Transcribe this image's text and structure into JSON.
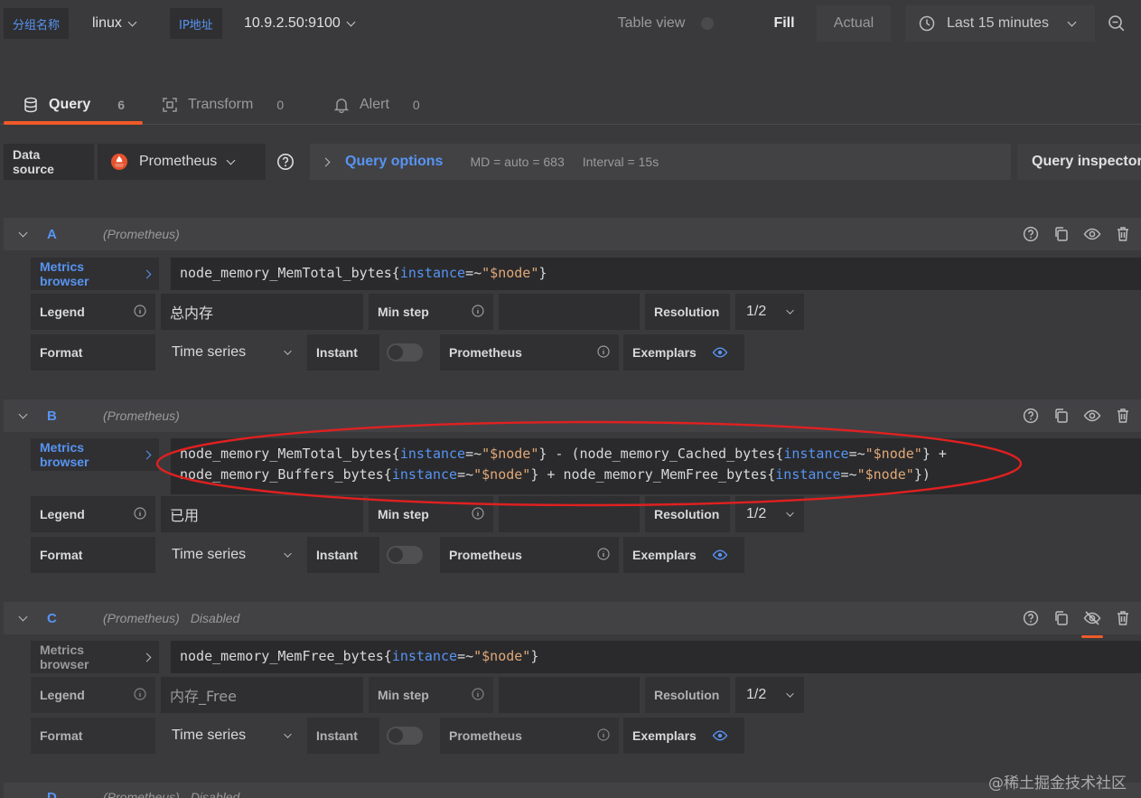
{
  "topbar": {
    "var1_label": "分组名称",
    "var1_value": "linux",
    "var2_label": "IP地址",
    "var2_value": "10.9.2.50:9100",
    "table_view_label": "Table view",
    "fill_label": "Fill",
    "actual_label": "Actual",
    "time_range": "Last 15 minutes"
  },
  "tabs": [
    {
      "label": "Query",
      "count": "6"
    },
    {
      "label": "Transform",
      "count": "0"
    },
    {
      "label": "Alert",
      "count": "0"
    }
  ],
  "datasource": {
    "label": "Data source",
    "value": "Prometheus",
    "query_options_label": "Query options",
    "md": "MD = auto = 683",
    "interval": "Interval = 15s",
    "inspector_label": "Query inspector"
  },
  "common": {
    "metrics_browser": "Metrics browser",
    "legend": "Legend",
    "min_step": "Min step",
    "resolution": "Resolution",
    "format": "Format",
    "format_value": "Time series",
    "instant": "Instant",
    "prometheus": "Prometheus",
    "exemplars": "Exemplars",
    "resolution_value": "1/2"
  },
  "queries": [
    {
      "letter": "A",
      "datasource": "(Prometheus)",
      "disabled": "",
      "expr_lines": [
        [
          [
            "node_memory_MemTotal_bytes{",
            "t"
          ],
          [
            "instance",
            "k"
          ],
          [
            "=~",
            "t"
          ],
          [
            "\"$node\"",
            "s"
          ],
          [
            "}",
            "t"
          ]
        ]
      ],
      "legend": "总内存"
    },
    {
      "letter": "B",
      "datasource": "(Prometheus)",
      "disabled": "",
      "expr_lines": [
        [
          [
            "node_memory_MemTotal_bytes{",
            "t"
          ],
          [
            "instance",
            "k"
          ],
          [
            "=~",
            "t"
          ],
          [
            "\"$node\"",
            "s"
          ],
          [
            "} - (node_memory_Cached_bytes{",
            "t"
          ],
          [
            "instance",
            "k"
          ],
          [
            "=~",
            "t"
          ],
          [
            "\"$node\"",
            "s"
          ],
          [
            "} +",
            "t"
          ]
        ],
        [
          [
            "node_memory_Buffers_bytes{",
            "t"
          ],
          [
            "instance",
            "k"
          ],
          [
            "=~",
            "t"
          ],
          [
            "\"$node\"",
            "s"
          ],
          [
            "} + node_memory_MemFree_bytes{",
            "t"
          ],
          [
            "instance",
            "k"
          ],
          [
            "=~",
            "t"
          ],
          [
            "\"$node\"",
            "s"
          ],
          [
            "})",
            "t"
          ]
        ]
      ],
      "legend": "已用"
    },
    {
      "letter": "C",
      "datasource": "(Prometheus)",
      "disabled": "Disabled",
      "expr_lines": [
        [
          [
            "node_memory_MemFree_bytes{",
            "t"
          ],
          [
            "instance",
            "k"
          ],
          [
            "=~",
            "t"
          ],
          [
            "\"$node\"",
            "s"
          ],
          [
            "}",
            "t"
          ]
        ]
      ],
      "legend": "内存_Free"
    },
    {
      "letter": "D",
      "datasource": "(Prometheus)",
      "disabled": "Disabled",
      "expr_lines": [],
      "legend": ""
    }
  ],
  "watermark": "@稀土掘金技术社区",
  "colors": {
    "accent": "#5794f2",
    "highlight_circle": "#e02020",
    "active_tab": "#f05a28"
  }
}
